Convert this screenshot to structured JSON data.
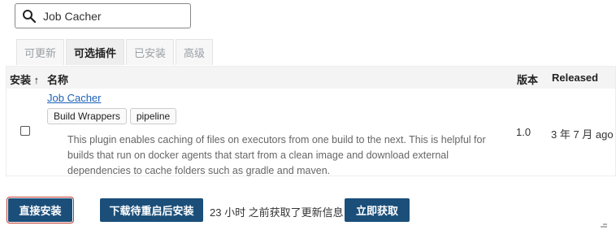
{
  "search": {
    "value": "Job Cacher",
    "icon": "search-icon"
  },
  "tabs": [
    {
      "label": "可更新",
      "active": false
    },
    {
      "label": "可选插件",
      "active": true
    },
    {
      "label": "已安装",
      "active": false
    },
    {
      "label": "高级",
      "active": false
    }
  ],
  "table": {
    "headers": {
      "install": "安装 ↑",
      "name": "名称",
      "version": "版本",
      "released": "Released"
    },
    "rows": [
      {
        "checked": false,
        "name": "Job Cacher",
        "tags": [
          "Build Wrappers",
          "pipeline"
        ],
        "description": "This plugin enables caching of files on executors from one build to the next. This is helpful for builds that run on docker agents that start from a clean image and download external dependencies to cache folders such as gradle and maven.",
        "version": "1.0",
        "released": "3 年 7 月 ago"
      }
    ]
  },
  "actions": {
    "install_now": "直接安装",
    "install_after_restart": "下载待重启后安装",
    "status": "23 小时 之前获取了更新信息",
    "fetch_now": "立即获取"
  },
  "colors": {
    "primary_button": "#1b4f7a",
    "link": "#1c62b8",
    "focus_outline": "#c0392b"
  }
}
